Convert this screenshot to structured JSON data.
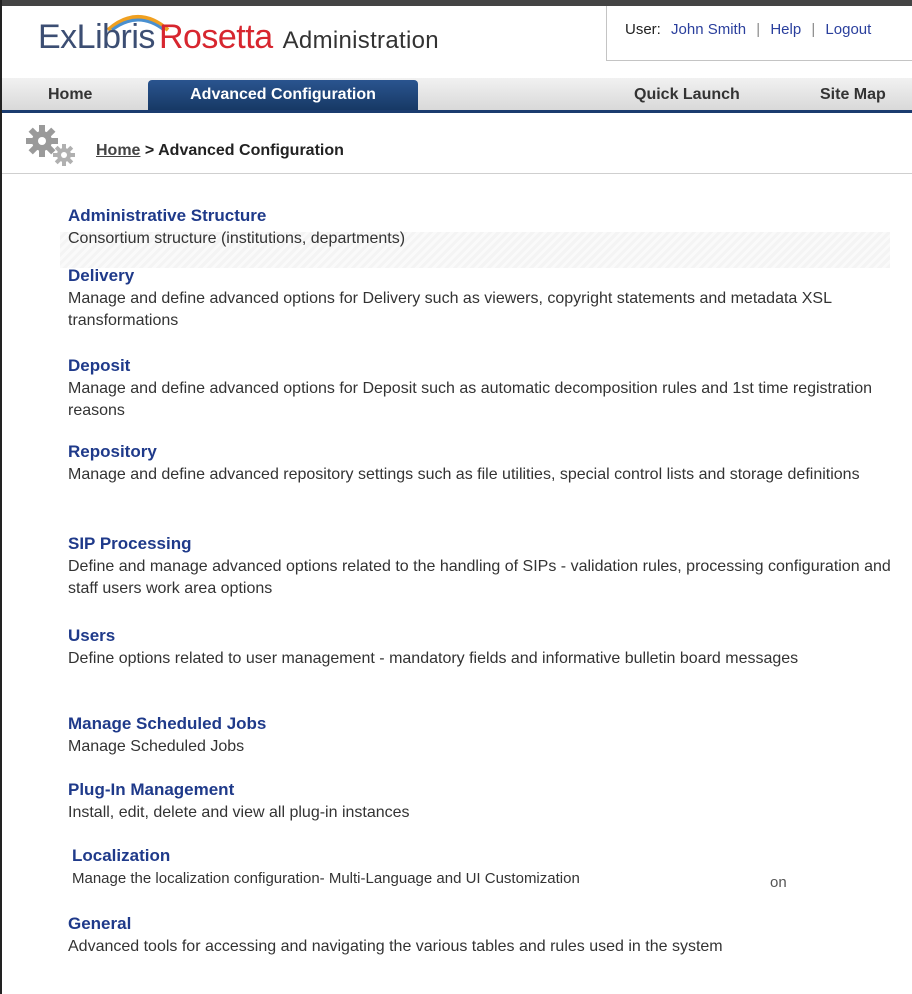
{
  "header": {
    "brand_exlibris": "ExLibris",
    "brand_rosetta": "Rosetta",
    "brand_admin": "Administration",
    "user_label": "User:",
    "user_name": "John Smith",
    "help": "Help",
    "logout": "Logout"
  },
  "nav": {
    "home": "Home",
    "advanced": "Advanced Configuration",
    "quick_launch": "Quick Launch",
    "site_map": "Site Map"
  },
  "breadcrumb": {
    "home": "Home",
    "separator": ">",
    "current": "Advanced Configuration"
  },
  "sections": [
    {
      "title": "Administrative Structure",
      "desc": "Consortium structure (institutions, departments)"
    },
    {
      "title": "Delivery",
      "desc": "Manage and define advanced options for Delivery such as viewers, copyright statements and metadata XSL transformations"
    },
    {
      "title": "Deposit",
      "desc": "Manage and define advanced options for Deposit such as automatic decomposition rules and 1st time registration reasons"
    },
    {
      "title": "Repository",
      "desc": "Manage and define advanced repository settings such as file utilities, special control lists and storage definitions"
    },
    {
      "title": "SIP Processing",
      "desc": "Define and manage advanced options related to the handling of SIPs - validation rules, processing configuration and staff users work area options"
    },
    {
      "title": "Users",
      "desc": "Define options related to user management - mandatory fields and informative bulletin board messages"
    },
    {
      "title": "Manage Scheduled Jobs",
      "desc": "Manage Scheduled Jobs"
    },
    {
      "title": "Plug-In Management",
      "desc": "Install, edit, delete and view all plug-in instances"
    },
    {
      "title": "Localization",
      "desc": "Manage the localization configuration- Multi-Language and UI Customization"
    },
    {
      "title": "General",
      "desc": "Advanced tools for accessing and navigating the various tables and rules used in the system"
    }
  ],
  "trailing_fragment": "on",
  "colors": {
    "link_blue": "#1f3a8a",
    "nav_active": "#1b3c6f",
    "brand_red": "#d7262f"
  }
}
